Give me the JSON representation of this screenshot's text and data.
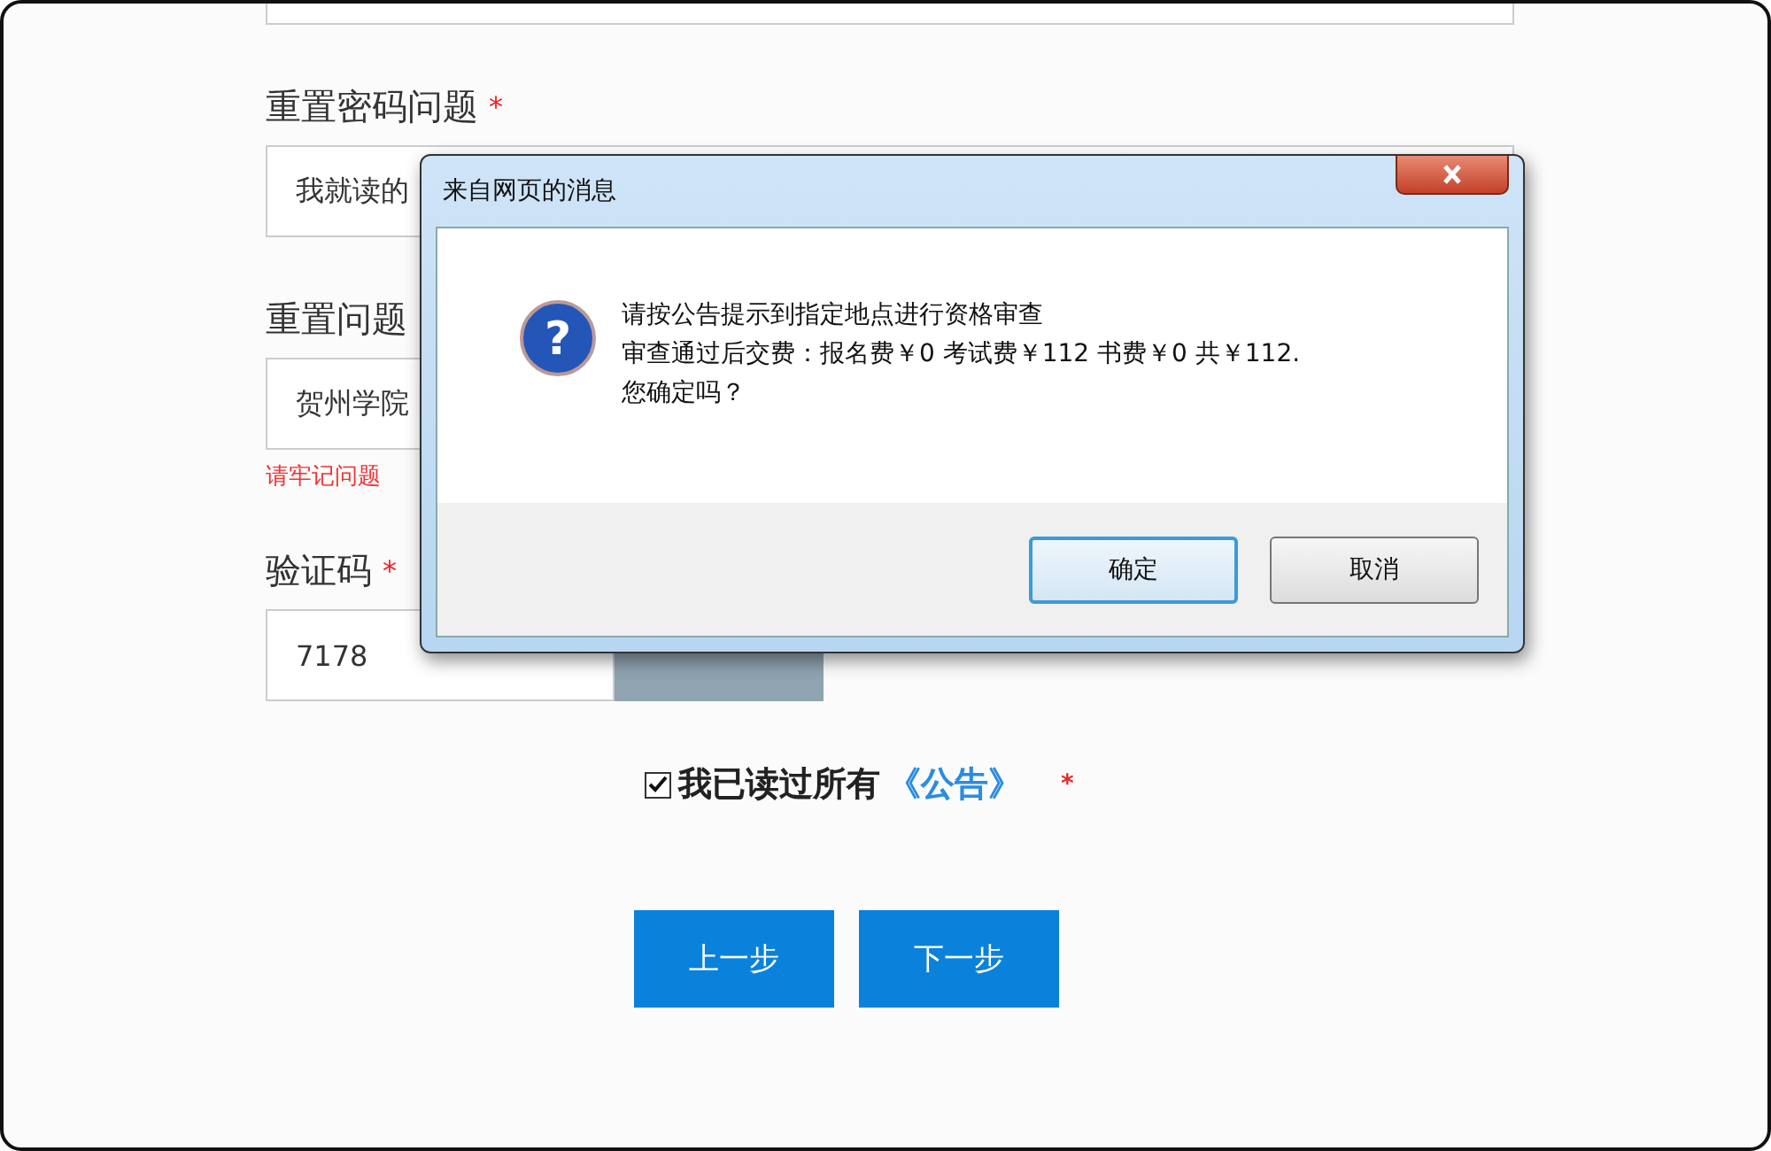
{
  "form": {
    "fields": [
      {
        "kind": "select",
        "label": "重置密码问题",
        "required_mark": "*",
        "value": "我就读的"
      },
      {
        "kind": "input",
        "label": "重置问题",
        "value": "贺州学院",
        "hint": "请牢记问题"
      },
      {
        "kind": "captcha",
        "label": "验证码",
        "required_mark": "*",
        "value": "7178"
      }
    ],
    "agreement": {
      "checked": true,
      "text": "我已读过所有",
      "link": "《公告》",
      "required_mark": "*"
    },
    "buttons": [
      "上一步",
      "下一步"
    ]
  },
  "dialog": {
    "title": "来自网页的消息",
    "icon": "?",
    "lines": [
      "请按公告提示到指定地点进行资格审查",
      "审查通过后交费：报名费￥0 考试费￥112 书费￥0 共￥112.",
      "您确定吗？"
    ],
    "buttons": [
      {
        "label": "确定",
        "selected": true
      },
      {
        "label": "取消",
        "selected": false
      }
    ]
  }
}
